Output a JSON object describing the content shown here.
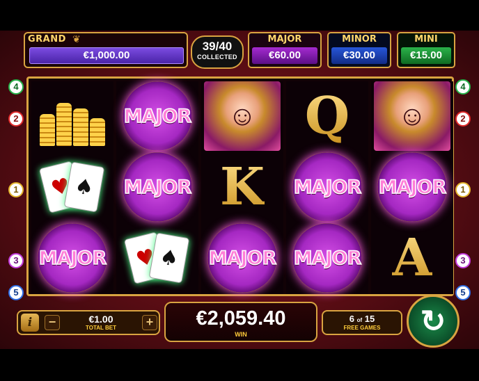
{
  "jackpots": {
    "grand": {
      "label": "GRAND",
      "value": "€1,000.00"
    },
    "collected": {
      "count": "39/40",
      "label": "COLLECTED"
    },
    "major": {
      "label": "MAJOR",
      "value": "€60.00"
    },
    "minor": {
      "label": "MINOR",
      "value": "€30.00"
    },
    "mini": {
      "label": "MINI",
      "value": "€15.00"
    }
  },
  "reels": [
    [
      "coins",
      "cards",
      "chip"
    ],
    [
      "chip",
      "chip",
      "cards"
    ],
    [
      "woman",
      "K",
      "chip"
    ],
    [
      "Q",
      "chip",
      "chip"
    ],
    [
      "woman",
      "chip",
      "A"
    ]
  ],
  "chip_label": "MAJOR",
  "paylines": {
    "left": [
      "4",
      "2",
      "1",
      "3",
      "5"
    ],
    "right": [
      "4",
      "2",
      "1",
      "3",
      "5"
    ]
  },
  "bottom": {
    "info": "i",
    "minus": "−",
    "plus": "+",
    "bet_value": "€1.00",
    "bet_label": "TOTAL BET",
    "win_value": "€2,059.40",
    "win_label": "WIN",
    "free_current": "6",
    "free_of": "of",
    "free_total": "15",
    "free_label": "FREE GAMES",
    "spin_icon": "↻"
  }
}
